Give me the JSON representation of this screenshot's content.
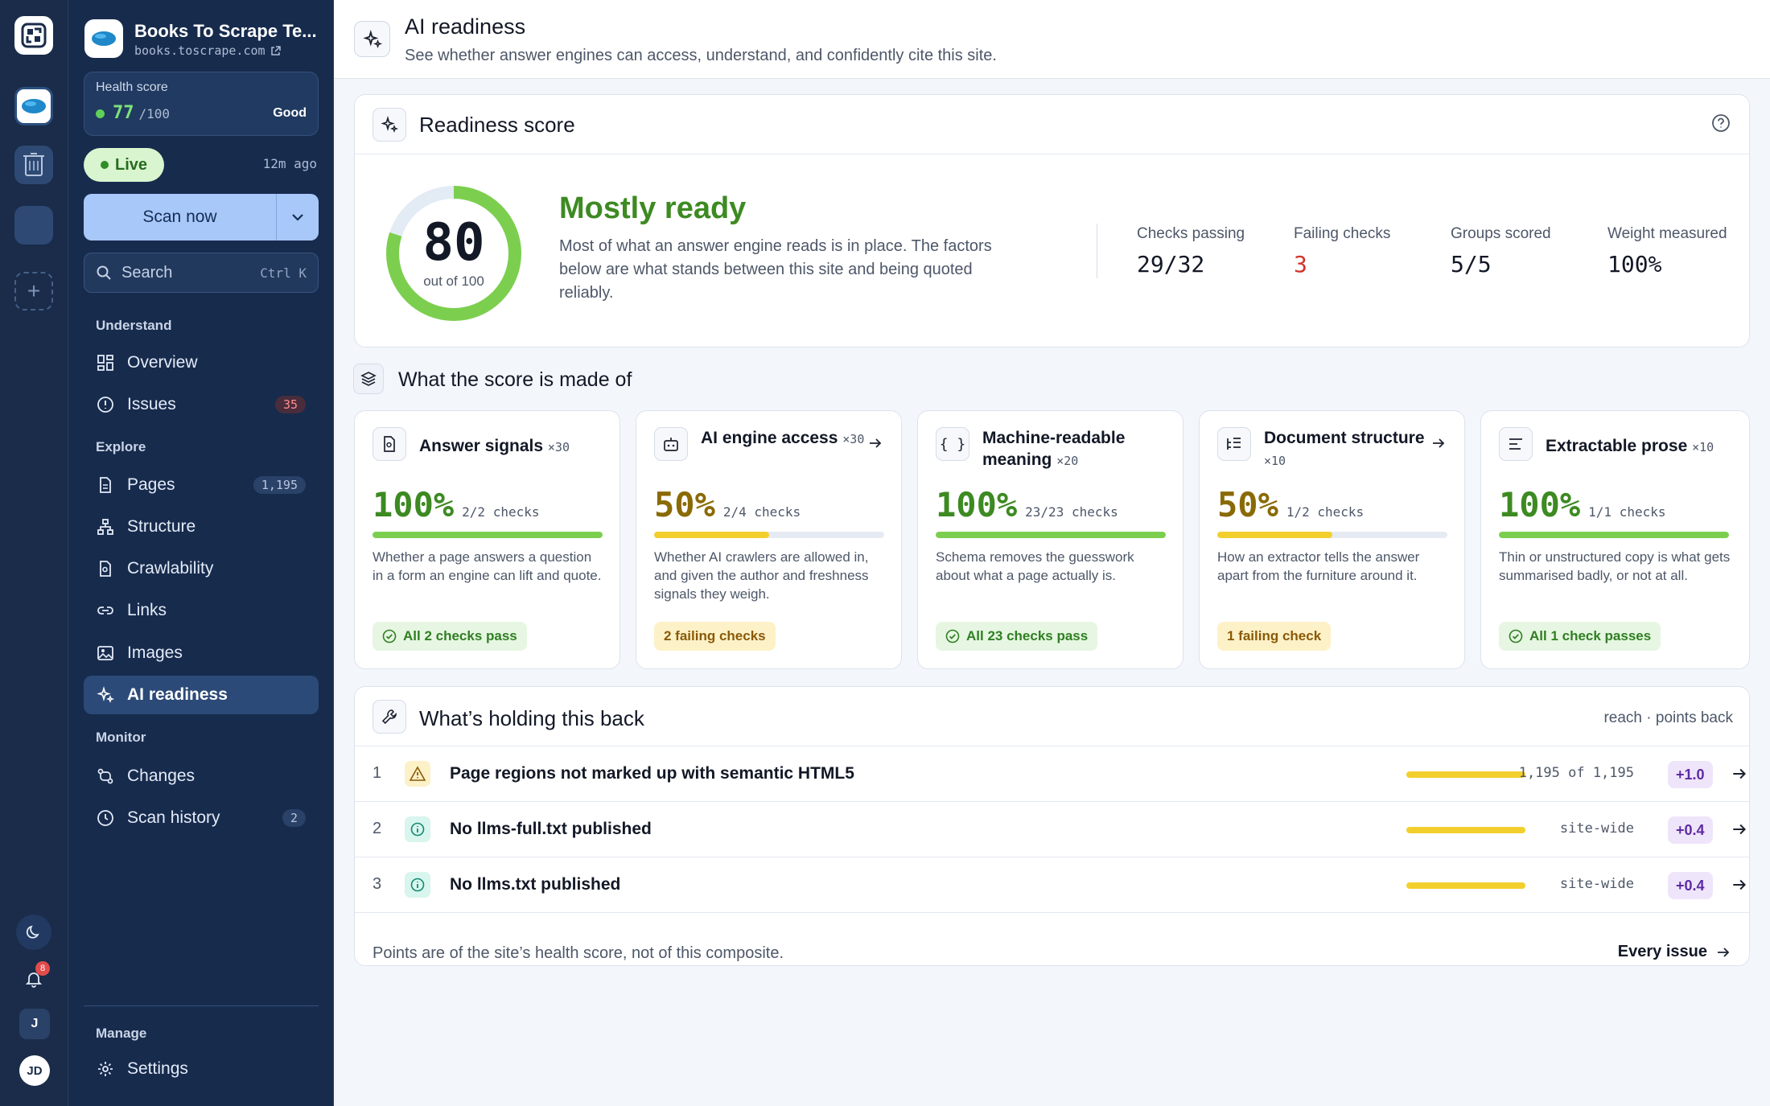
{
  "rail": {
    "notifications_count": "8",
    "user_initial": "J",
    "avatar_initials": "JD"
  },
  "sidebar": {
    "site_name": "Books To Scrape Te...",
    "site_url": "books.toscrape.com",
    "health": {
      "label": "Health score",
      "value": "77",
      "denominator": "/100",
      "status": "Good"
    },
    "live_label": "Live",
    "last_scan": "12m ago",
    "scan_button": "Scan now",
    "search": {
      "placeholder": "Search",
      "shortcut": "Ctrl K"
    },
    "sections": {
      "understand": "Understand",
      "explore": "Explore",
      "monitor": "Monitor",
      "manage": "Manage"
    },
    "items": {
      "overview": {
        "label": "Overview"
      },
      "issues": {
        "label": "Issues",
        "badge": "35"
      },
      "pages": {
        "label": "Pages",
        "badge": "1,195"
      },
      "structure": {
        "label": "Structure"
      },
      "crawlability": {
        "label": "Crawlability"
      },
      "links": {
        "label": "Links"
      },
      "images": {
        "label": "Images"
      },
      "ai_readiness": {
        "label": "AI readiness"
      },
      "changes": {
        "label": "Changes"
      },
      "scan_history": {
        "label": "Scan history",
        "badge": "2"
      },
      "settings": {
        "label": "Settings"
      }
    }
  },
  "header": {
    "title": "AI readiness",
    "subtitle": "See whether answer engines can access, understand, and confidently cite this site."
  },
  "readiness": {
    "title": "Readiness score",
    "score": "80",
    "score_value": 80,
    "score_max": "out of 100",
    "verdict": "Mostly ready",
    "description": "Most of what an answer engine reads is in place. The factors below are what stands between this site and being quoted reliably.",
    "stats": [
      {
        "label": "Checks passing",
        "value": "29/32"
      },
      {
        "label": "Failing checks",
        "value": "3"
      },
      {
        "label": "Groups scored",
        "value": "5/5"
      },
      {
        "label": "Weight measured",
        "value": "100%"
      }
    ]
  },
  "composition": {
    "title": "What the score is made of",
    "groups": [
      {
        "title": "Answer signals",
        "weight": "×30",
        "pct": "100%",
        "fill": 1.0,
        "checks": "2/2 checks",
        "desc": "Whether a page answers a question in a form an engine can lift and quote.",
        "status": "All 2 checks pass"
      },
      {
        "title": "AI engine access",
        "weight": "×30",
        "pct": "50%",
        "fill": 0.5,
        "checks": "2/4 checks",
        "desc": "Whether AI crawlers are allowed in, and given the author and freshness signals they weigh.",
        "status": "2 failing checks"
      },
      {
        "title": "Machine-readable meaning",
        "weight": "×20",
        "pct": "100%",
        "fill": 1.0,
        "checks": "23/23 checks",
        "desc": "Schema removes the guesswork about what a page actually is.",
        "status": "All 23 checks pass"
      },
      {
        "title": "Document structure",
        "weight": "×10",
        "pct": "50%",
        "fill": 0.5,
        "checks": "1/2 checks",
        "desc": "How an extractor tells the answer apart from the furniture around it.",
        "status": "1 failing check"
      },
      {
        "title": "Extractable prose",
        "weight": "×10",
        "pct": "100%",
        "fill": 1.0,
        "checks": "1/1 checks",
        "desc": "Thin or unstructured copy is what gets summarised badly, or not at all.",
        "status": "All 1 check passes"
      }
    ]
  },
  "holding": {
    "title": "What’s holding this back",
    "meta": "reach · points back",
    "rows": [
      {
        "n": "1",
        "title": "Page regions not marked up with semantic HTML5",
        "reach": "1,195 of 1,195",
        "reach_fraction": 1.0,
        "points": "+1.0"
      },
      {
        "n": "2",
        "title": "No llms-full.txt published",
        "reach": "site-wide",
        "reach_fraction": 1.0,
        "points": "+0.4"
      },
      {
        "n": "3",
        "title": "No llms.txt published",
        "reach": "site-wide",
        "reach_fraction": 1.0,
        "points": "+0.4"
      }
    ],
    "footer": "Points are of the site’s health score, not of this composite.",
    "footer_link": "Every issue"
  },
  "colors": {
    "pass": "#7ccf4e",
    "warn": "#f3cf2e",
    "accent": "#a7c8f9",
    "sidebar": "#172b4d"
  }
}
